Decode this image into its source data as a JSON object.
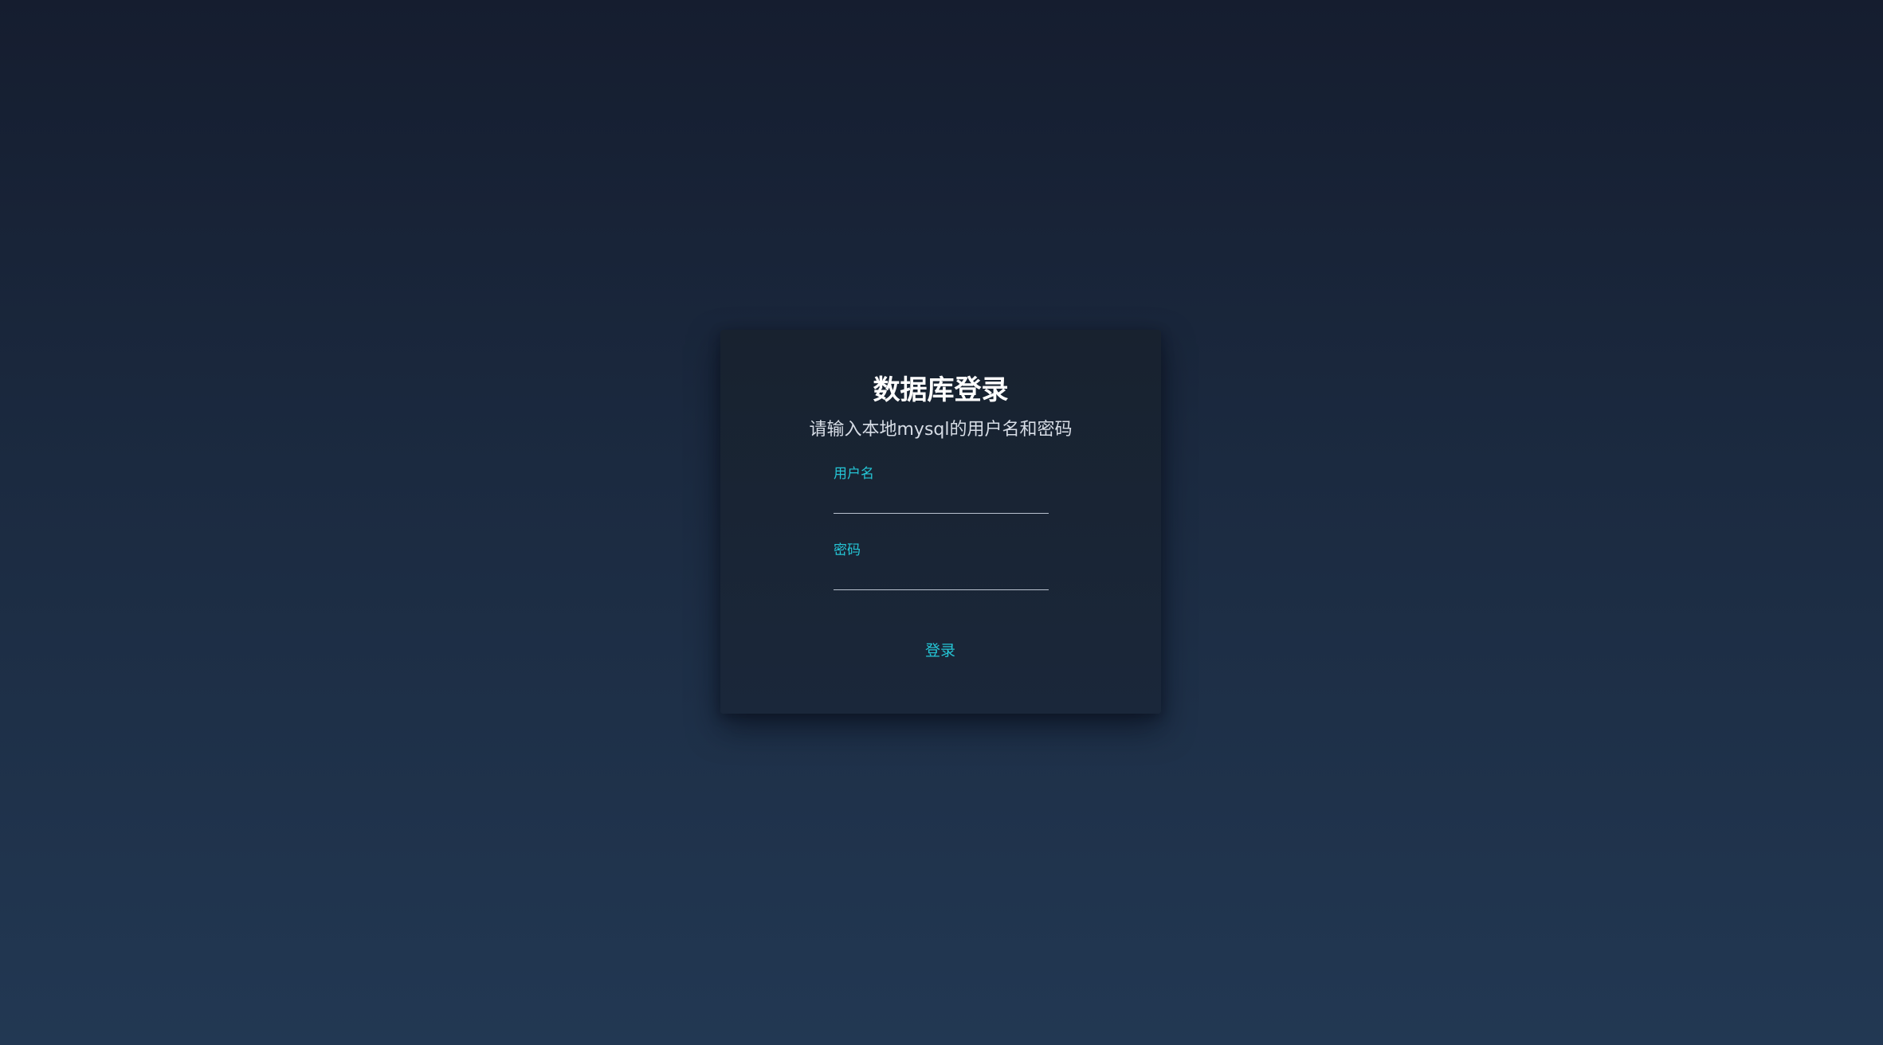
{
  "login": {
    "title": "数据库登录",
    "subtitle": "请输入本地mysql的用户名和密码",
    "username_label": "用户名",
    "username_value": "",
    "password_label": "密码",
    "password_value": "",
    "submit_label": "登录"
  },
  "colors": {
    "accent": "#25c6d6",
    "background_top": "#151d2f",
    "background_bottom": "#223853",
    "card": "#18222f"
  }
}
